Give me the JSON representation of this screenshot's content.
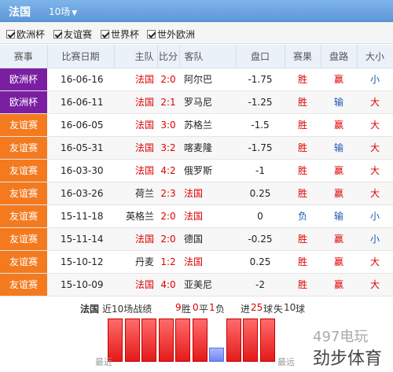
{
  "header": {
    "team": "法国",
    "match_count": "10场"
  },
  "filters": [
    {
      "label": "欧洲杯",
      "checked": true
    },
    {
      "label": "友谊赛",
      "checked": true
    },
    {
      "label": "世界杯",
      "checked": true
    },
    {
      "label": "世外欧洲",
      "checked": true
    }
  ],
  "table": {
    "headers": [
      "赛事",
      "比赛日期",
      "主队",
      "比分",
      "客队",
      "盘口",
      "赛果",
      "盘路",
      "大小"
    ],
    "rows": [
      {
        "league": "欧洲杯",
        "date": "16-06-16",
        "home": "法国",
        "score": "2:0",
        "away": "阿尔巴",
        "handicap": "-1.75",
        "result": "胜",
        "cover": "赢",
        "ou": "小",
        "league_color": "#7b1fa2"
      },
      {
        "league": "欧洲杯",
        "date": "16-06-11",
        "home": "法国",
        "score": "2:1",
        "away": "罗马尼",
        "handicap": "-1.25",
        "result": "胜",
        "cover": "输",
        "ou": "大",
        "league_color": "#7b1fa2"
      },
      {
        "league": "友谊赛",
        "date": "16-06-05",
        "home": "法国",
        "score": "3:0",
        "away": "苏格兰",
        "handicap": "-1.5",
        "result": "胜",
        "cover": "赢",
        "ou": "大",
        "league_color": "#f47a20"
      },
      {
        "league": "友谊赛",
        "date": "16-05-31",
        "home": "法国",
        "score": "3:2",
        "away": "喀麦隆",
        "handicap": "-1.75",
        "result": "胜",
        "cover": "输",
        "ou": "大",
        "league_color": "#f47a20"
      },
      {
        "league": "友谊赛",
        "date": "16-03-30",
        "home": "法国",
        "score": "4:2",
        "away": "俄罗斯",
        "handicap": "-1",
        "result": "胜",
        "cover": "赢",
        "ou": "大",
        "league_color": "#f47a20"
      },
      {
        "league": "友谊赛",
        "date": "16-03-26",
        "home": "荷兰",
        "score": "2:3",
        "away": "法国",
        "handicap": "0.25",
        "result": "胜",
        "cover": "赢",
        "ou": "大",
        "league_color": "#f47a20"
      },
      {
        "league": "友谊赛",
        "date": "15-11-18",
        "home": "英格兰",
        "score": "2:0",
        "away": "法国",
        "handicap": "0",
        "result": "负",
        "cover": "输",
        "ou": "小",
        "league_color": "#f47a20"
      },
      {
        "league": "友谊赛",
        "date": "15-11-14",
        "home": "法国",
        "score": "2:0",
        "away": "德国",
        "handicap": "-0.25",
        "result": "胜",
        "cover": "赢",
        "ou": "小",
        "league_color": "#f47a20"
      },
      {
        "league": "友谊赛",
        "date": "15-10-12",
        "home": "丹麦",
        "score": "1:2",
        "away": "法国",
        "handicap": "0.25",
        "result": "胜",
        "cover": "赢",
        "ou": "大",
        "league_color": "#f47a20"
      },
      {
        "league": "友谊赛",
        "date": "15-10-09",
        "home": "法国",
        "score": "4:0",
        "away": "亚美尼",
        "handicap": "-2",
        "result": "胜",
        "cover": "赢",
        "ou": "大",
        "league_color": "#f47a20"
      }
    ]
  },
  "summary": {
    "team": "法国",
    "recent_label": "近10场战绩",
    "wins": "9",
    "win_label": "胜",
    "draws": "0",
    "draw_label": "平",
    "losses": "1",
    "loss_label": "负",
    "scored_label": "进",
    "scored": "25",
    "scored_unit": "球",
    "conceded_label": "失",
    "conceded": "10",
    "conceded_unit": "球"
  },
  "form_chart": {
    "results": [
      "胜",
      "胜",
      "胜",
      "胜",
      "胜",
      "胜",
      "负",
      "胜",
      "胜",
      "胜"
    ],
    "left_label": "最近",
    "right_label": "最远"
  },
  "watermark": "497电玩",
  "brand": "劲步体育"
}
